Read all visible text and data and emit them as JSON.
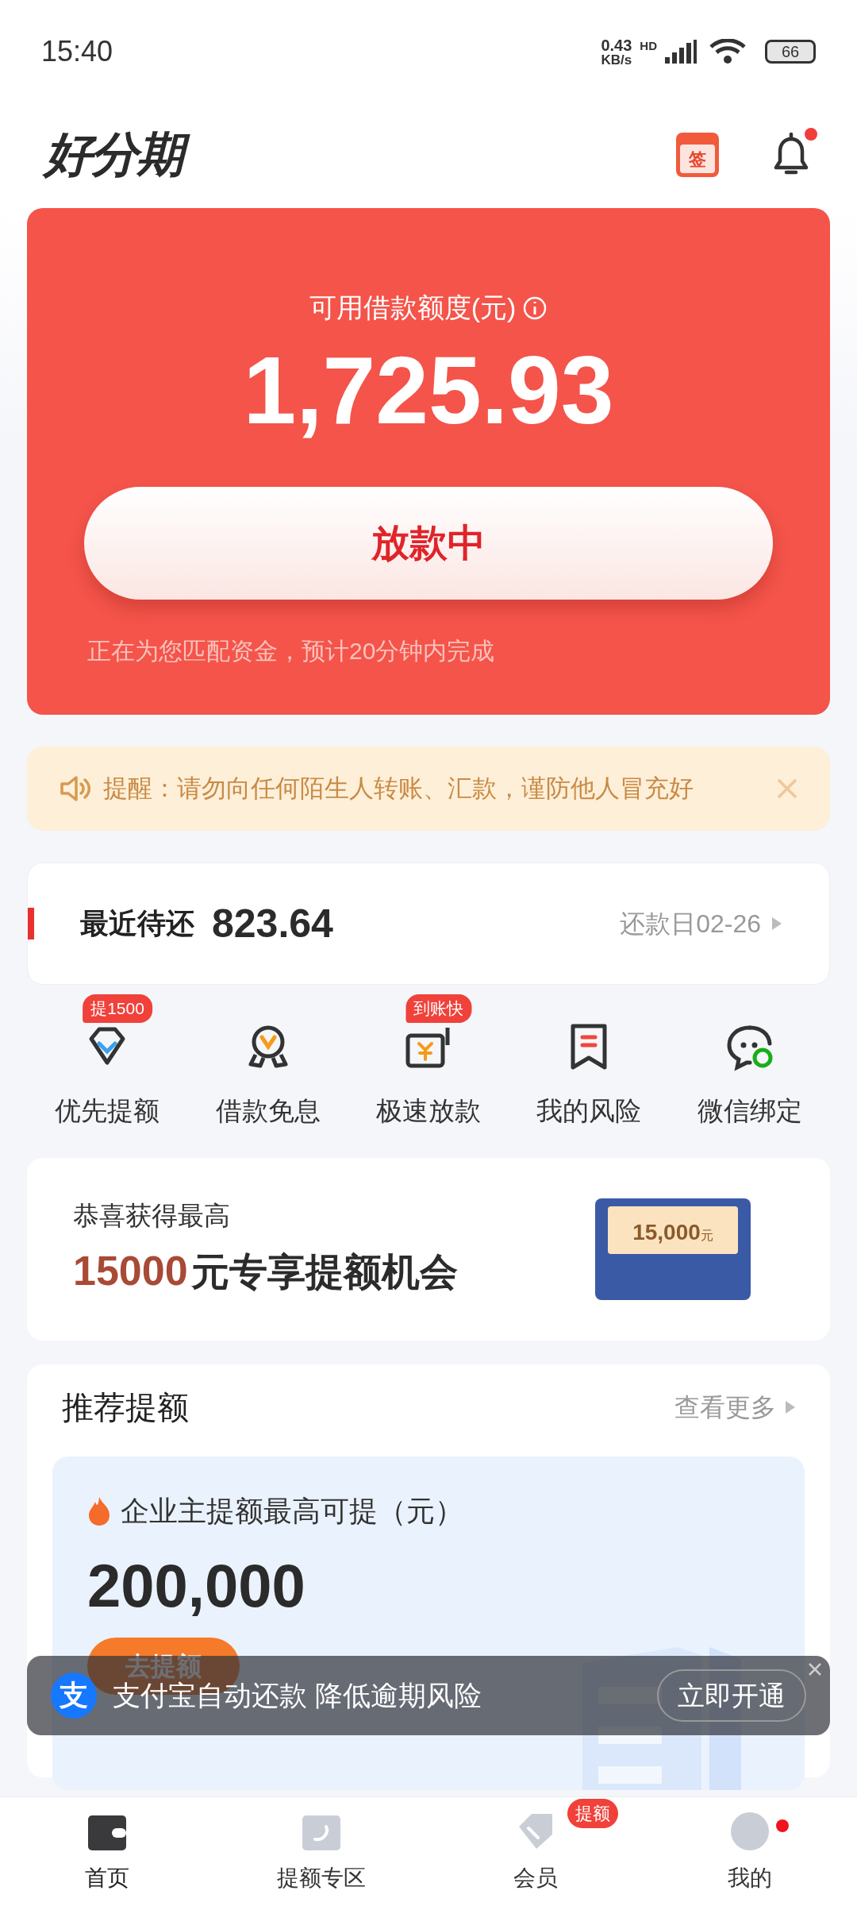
{
  "status_bar": {
    "time": "15:40",
    "net_speed": "0.43",
    "net_unit": "KB/s",
    "network": "HD",
    "battery": "66"
  },
  "header": {
    "logo": "好分期",
    "sign_label": "签",
    "bell_dot": true
  },
  "credit_card": {
    "label": "可用借款额度(元)",
    "amount": "1,725.93",
    "button": "放款中",
    "note": "正在为您匹配资金，预计20分钟内完成"
  },
  "notice": {
    "text": "提醒：请勿向任何陌生人转账、汇款，谨防他人冒充好"
  },
  "repayment": {
    "label": "最近待还",
    "amount": "823.64",
    "due": "还款日02-26"
  },
  "shortcuts": [
    {
      "kind": "diamond",
      "label": "优先提额",
      "badge": "提1500"
    },
    {
      "kind": "medal",
      "label": "借款免息"
    },
    {
      "kind": "wallet",
      "label": "极速放款",
      "badge": "到账快"
    },
    {
      "kind": "bookmark",
      "label": "我的风险"
    },
    {
      "kind": "chat",
      "label": "微信绑定"
    }
  ],
  "promo": {
    "line1": "恭喜获得最高",
    "highlight": "15000",
    "line2": "元专享提额机会",
    "envelope_amount": "15,000",
    "envelope_unit": "元"
  },
  "recommend": {
    "title": "推荐提额",
    "more": "查看更多",
    "card": {
      "title": "企业主提额最高可提（元）",
      "amount": "200,000",
      "button": "去提额"
    }
  },
  "toast": {
    "logo": "支",
    "text": "支付宝自动还款 降低逾期风险",
    "button": "立即开通"
  },
  "nav": [
    {
      "kind": "wallet",
      "label": "首页",
      "selected": true
    },
    {
      "kind": "phone",
      "label": "提额专区",
      "selected": false
    },
    {
      "kind": "tag",
      "label": "会员",
      "selected": false,
      "badge": "提额"
    },
    {
      "kind": "avatar",
      "label": "我的",
      "selected": false,
      "dot": true
    }
  ]
}
